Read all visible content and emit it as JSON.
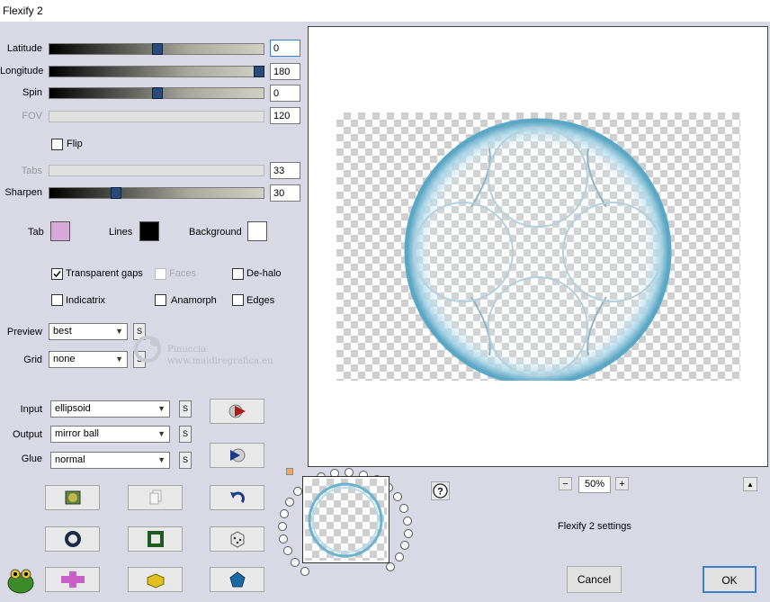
{
  "window": {
    "title": "Flexify 2"
  },
  "sliders": [
    {
      "label": "Latitude",
      "value": "0",
      "level": 0.5,
      "enabled": true,
      "focused": true
    },
    {
      "label": "Longitude",
      "value": "180",
      "level": 1.0,
      "enabled": true,
      "focused": false
    },
    {
      "label": "Spin",
      "value": "0",
      "level": 0.5,
      "enabled": true,
      "focused": false
    },
    {
      "label": "FOV",
      "value": "120",
      "level": null,
      "enabled": false,
      "focused": false
    }
  ],
  "flip": {
    "label": "Flip",
    "checked": false
  },
  "sliders2": [
    {
      "label": "Tabs",
      "value": "33",
      "level": null,
      "enabled": false
    },
    {
      "label": "Sharpen",
      "value": "30",
      "level": 0.3,
      "enabled": true
    }
  ],
  "colors": {
    "tab_label": "Tab",
    "tab_color": "#d8a8d8",
    "lines_label": "Lines",
    "lines_color": "#000000",
    "background_label": "Background",
    "background_color": "#ffffff"
  },
  "options": {
    "transparent_gaps": {
      "label": "Transparent gaps",
      "checked": true
    },
    "faces": {
      "label": "Faces",
      "checked": false,
      "enabled": false
    },
    "de_halo": {
      "label": "De-halo",
      "checked": false
    },
    "indicatrix": {
      "label": "Indicatrix",
      "checked": false
    },
    "anamorph": {
      "label": "Anamorph",
      "checked": false
    },
    "edges": {
      "label": "Edges",
      "checked": false
    }
  },
  "preview_select": {
    "label": "Preview",
    "value": "best"
  },
  "grid_select": {
    "label": "Grid",
    "value": "none"
  },
  "watermark": {
    "line1": "Pinuccia",
    "line2": "www.maidiregrafica.eu"
  },
  "input_select": {
    "label": "Input",
    "value": "ellipsoid"
  },
  "output_select": {
    "label": "Output",
    "value": "mirror ball"
  },
  "glue_select": {
    "label": "Glue",
    "value": "normal"
  },
  "s_label": "S",
  "zoom": {
    "minus": "−",
    "value": "50%",
    "plus": "+"
  },
  "help": "?",
  "caret": "▲",
  "settings_label": "Flexify 2 settings",
  "cancel": "Cancel",
  "ok": "OK",
  "brand": {
    "accent": "#3c7fd0",
    "thumb": "#2a4a7a"
  }
}
